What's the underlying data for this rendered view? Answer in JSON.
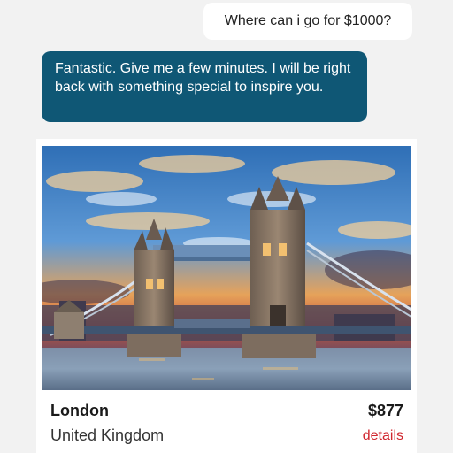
{
  "chat": {
    "user_message": "Where can i go for $1000?",
    "bot_message": "Fantastic. Give me a few minutes. I will be right back with something special to inspire you."
  },
  "result_card": {
    "image_subject": "tower-bridge-photo",
    "city": "London",
    "country": "United Kingdom",
    "price": "$877",
    "details_link": "details"
  },
  "colors": {
    "background": "#f2f2f2",
    "bot_bubble": "#0f5775",
    "details_link": "#d0262e"
  }
}
